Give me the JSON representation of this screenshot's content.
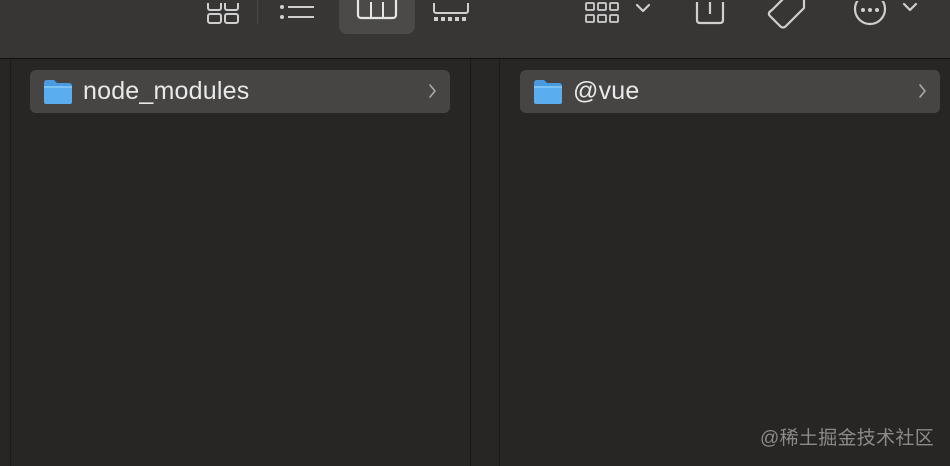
{
  "toolbar": {
    "buttons": [
      {
        "icon": "icon-view-icon"
      },
      {
        "icon": "list-view-icon"
      },
      {
        "icon": "column-view-icon",
        "selected": true
      },
      {
        "icon": "gallery-view-icon"
      },
      {
        "icon": "group-icon"
      },
      {
        "icon": "share-icon"
      },
      {
        "icon": "tag-icon"
      },
      {
        "icon": "more-actions-icon"
      }
    ]
  },
  "columns": [
    {
      "item": {
        "label": "node_modules",
        "icon": "folder-icon"
      }
    },
    {
      "item": {
        "label": "@vue",
        "icon": "folder-icon"
      }
    }
  ],
  "watermark": "@稀土掘金技术社区",
  "colors": {
    "folder": "#5aaef0",
    "selection": "#464544",
    "background": "#272625"
  }
}
